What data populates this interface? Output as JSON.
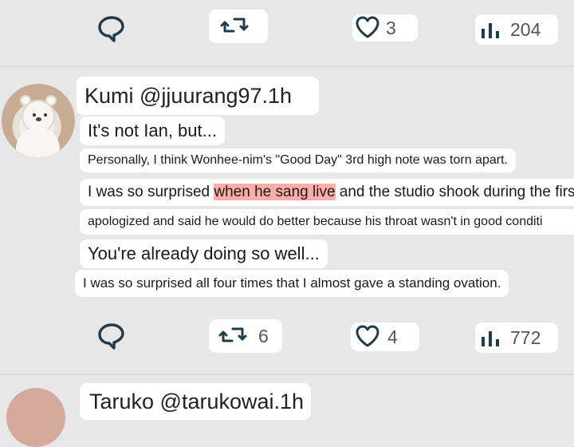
{
  "top_actions": {
    "like_count": "3",
    "views_count": "204"
  },
  "post": {
    "header": "Kumi @jjuurang97.1h",
    "lines": {
      "l1": "It's not Ian, but...",
      "l2": "Personally, I think Wonhee-nim's \"Good Day\" 3rd high note was torn apart.",
      "l3_before": "I was so surprised ",
      "l3_highlight": "when he sang live",
      "l3_after": " and the studio shook during the firs",
      "l4": "apologized and said he would do better because his throat wasn't in good conditi",
      "l5": "You're already doing so well...",
      "l6": "I was so surprised all four times that I almost gave a standing ovation."
    },
    "actions": {
      "retweet_count": "6",
      "like_count": "4",
      "views_count": "772"
    }
  },
  "next_post": {
    "header": "Taruko @tarukowai.1h"
  },
  "colors": {
    "background": "#e7e7e7",
    "pill": "#ffffff",
    "icon": "#1f3b4c",
    "highlight": "#ff695f"
  }
}
